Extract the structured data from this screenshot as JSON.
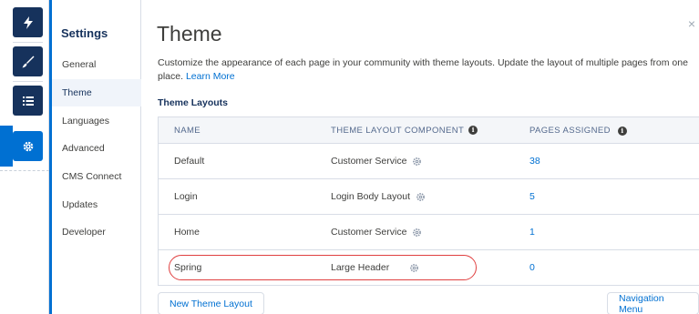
{
  "rail": {
    "items": [
      {
        "icon": "lightning-icon"
      },
      {
        "icon": "brush-icon"
      },
      {
        "icon": "list-icon"
      },
      {
        "icon": "gear-icon"
      }
    ],
    "accent": "#0070d2",
    "dark": "#16325c"
  },
  "settings": {
    "title": "Settings",
    "items": [
      {
        "label": "General"
      },
      {
        "label": "Theme"
      },
      {
        "label": "Languages"
      },
      {
        "label": "Advanced"
      },
      {
        "label": "CMS Connect"
      },
      {
        "label": "Updates"
      },
      {
        "label": "Developer"
      }
    ],
    "active_index": 1
  },
  "main": {
    "title": "Theme",
    "close_glyph": "×",
    "description": "Customize the appearance of each page in your community with theme layouts. Update the layout of multiple pages from one place.",
    "learn_more": "Learn More",
    "section_title": "Theme Layouts",
    "columns": {
      "name": "NAME",
      "component": "THEME LAYOUT COMPONENT",
      "pages": "PAGES ASSIGNED"
    },
    "rows": [
      {
        "name": "Default",
        "component": "Customer Service",
        "pages": "38"
      },
      {
        "name": "Login",
        "component": "Login Body Layout",
        "pages": "5"
      },
      {
        "name": "Home",
        "component": "Customer Service",
        "pages": "1"
      },
      {
        "name": "Spring",
        "component": "Large Header",
        "pages": "0"
      }
    ],
    "new_button": "New Theme Layout",
    "navmenu_button": "Navigation Menu",
    "info_glyph": "i"
  }
}
